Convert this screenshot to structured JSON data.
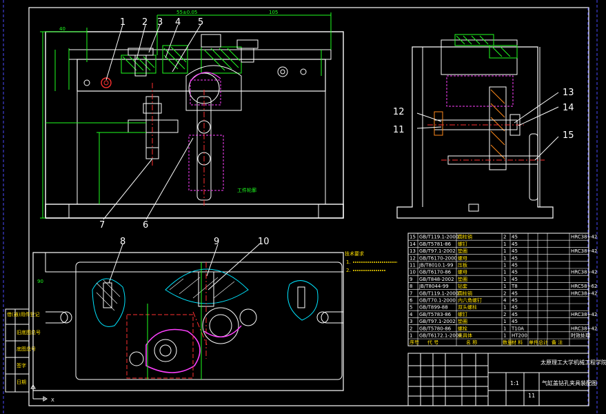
{
  "drawing": {
    "callouts_main": [
      "1",
      "2",
      "3",
      "4",
      "5",
      "6",
      "7"
    ],
    "callouts_right": [
      "11",
      "12",
      "13",
      "14",
      "15"
    ],
    "callouts_bottom": [
      "8",
      "9",
      "10"
    ],
    "notes": {
      "title": "技术要求",
      "lines": [
        "1.",
        "2."
      ]
    },
    "left_strip": {
      "labels": [
        "借(通)用件登记",
        "旧底图总号",
        "底图总号",
        "签字",
        "日期"
      ]
    },
    "parts_table": {
      "rows": [
        {
          "no": "15",
          "code": "GB/T119.1-2000",
          "name": "圆柱销",
          "qty": "2",
          "mat": "45",
          "note": "HRC38~42"
        },
        {
          "no": "14",
          "code": "GB/T5781-86",
          "name": "螺钉",
          "qty": "1",
          "mat": "45",
          "note": ""
        },
        {
          "no": "13",
          "code": "GB/T97.1-2002",
          "name": "垫圈",
          "qty": "1",
          "mat": "45",
          "note": "HRC38~42"
        },
        {
          "no": "12",
          "code": "GB/T6170-2000",
          "name": "螺母",
          "qty": "1",
          "mat": "45",
          "note": ""
        },
        {
          "no": "11",
          "code": "JB/T8010.1-99",
          "name": "压板",
          "qty": "1",
          "mat": "45",
          "note": ""
        },
        {
          "no": "10",
          "code": "GB/T6170-86",
          "name": "螺母",
          "qty": "1",
          "mat": "45",
          "note": "HRC38~42"
        },
        {
          "no": "9",
          "code": "GB/T848-2002",
          "name": "垫圈",
          "qty": "1",
          "mat": "45",
          "note": ""
        },
        {
          "no": "8",
          "code": "JB/T8044-99",
          "name": "钻套",
          "qty": "1",
          "mat": "T8",
          "note": "HRC58~62"
        },
        {
          "no": "7",
          "code": "GB/T119.1-2000",
          "name": "圆柱销",
          "qty": "2",
          "mat": "45",
          "note": "HRC38~42"
        },
        {
          "no": "6",
          "code": "GB/T70.1-2000",
          "name": "内六角螺钉",
          "qty": "4",
          "mat": "45",
          "note": ""
        },
        {
          "no": "5",
          "code": "GB/T899-88",
          "name": "双头螺柱",
          "qty": "1",
          "mat": "45",
          "note": ""
        },
        {
          "no": "4",
          "code": "GB/T5783-86",
          "name": "螺钉",
          "qty": "2",
          "mat": "45",
          "note": "HRC38~42"
        },
        {
          "no": "3",
          "code": "GB/T97.1-2002",
          "name": "垫圈",
          "qty": "1",
          "mat": "45",
          "note": ""
        },
        {
          "no": "2",
          "code": "GB/T5780-86",
          "name": "螺栓",
          "qty": "1",
          "mat": "T10A",
          "note": "HRC38~42"
        },
        {
          "no": "1",
          "code": "GB/T6172.1-2000",
          "name": "夹具体",
          "qty": "1",
          "mat": "HT200",
          "note": "时效处理"
        }
      ],
      "header": [
        "序号",
        "代 号",
        "名 称",
        "数量",
        "材 料",
        "单件",
        "总计",
        "备 注"
      ]
    },
    "title_block": {
      "school": "太原理工大学机械工程学院",
      "drawing_title": "气缸盖钻孔夹具装配图",
      "scale": "1:1",
      "sheet": "11"
    }
  }
}
